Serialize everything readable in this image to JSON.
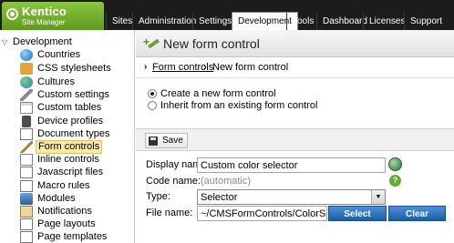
{
  "header": {
    "logo_title": "Kentico",
    "logo_subtitle": "Site Manager",
    "tabs": [
      {
        "label": "Sites"
      },
      {
        "label": "Administration"
      },
      {
        "label": "Settings"
      },
      {
        "label": "Development"
      },
      {
        "label": "Tools"
      },
      {
        "label": "Dashboard"
      },
      {
        "label": "Licenses"
      },
      {
        "label": "Support"
      }
    ],
    "active_tab": "Development"
  },
  "sidebar": {
    "root_label": "Development",
    "items": [
      {
        "label": "Countries",
        "icon": "globe-icon"
      },
      {
        "label": "CSS stylesheets",
        "icon": "css-icon"
      },
      {
        "label": "Cultures",
        "icon": "culture-icon"
      },
      {
        "label": "Custom settings",
        "icon": "wrench-icon"
      },
      {
        "label": "Custom tables",
        "icon": "table-icon"
      },
      {
        "label": "Device profiles",
        "icon": "device-icon"
      },
      {
        "label": "Document types",
        "icon": "document-icon"
      },
      {
        "label": "Form controls",
        "icon": "form-control-icon"
      },
      {
        "label": "Inline controls",
        "icon": "inline-control-icon"
      },
      {
        "label": "Javascript files",
        "icon": "javascript-icon"
      },
      {
        "label": "Macro rules",
        "icon": "macro-icon"
      },
      {
        "label": "Modules",
        "icon": "module-icon"
      },
      {
        "label": "Notifications",
        "icon": "notification-icon"
      },
      {
        "label": "Page layouts",
        "icon": "layout-icon"
      },
      {
        "label": "Page templates",
        "icon": "template-icon"
      }
    ],
    "selected_item": "Form controls"
  },
  "main": {
    "title": "New form control",
    "breadcrumb": {
      "link": "Form controls",
      "current": "New form control"
    },
    "options": [
      {
        "label": "Create a new form control",
        "checked": true
      },
      {
        "label": "Inherit from an existing form control",
        "checked": false
      }
    ],
    "save_label": "Save",
    "fields": {
      "display_name_label": "Display name:",
      "display_name_value": "Custom color selector",
      "code_name_label": "Code name:",
      "code_name_value": "(automatic)",
      "type_label": "Type:",
      "type_value": "Selector",
      "file_name_label": "File name:",
      "file_name_value": "~/CMSFormControls/ColorSelecto",
      "select_button": "Select",
      "clear_button": "Clear"
    }
  },
  "colors": {
    "header_bg": "#1c1c1c",
    "logo_green": "#8cc63f",
    "selected_bg": "#fde9a6",
    "button_blue": "#1d5ea8"
  }
}
